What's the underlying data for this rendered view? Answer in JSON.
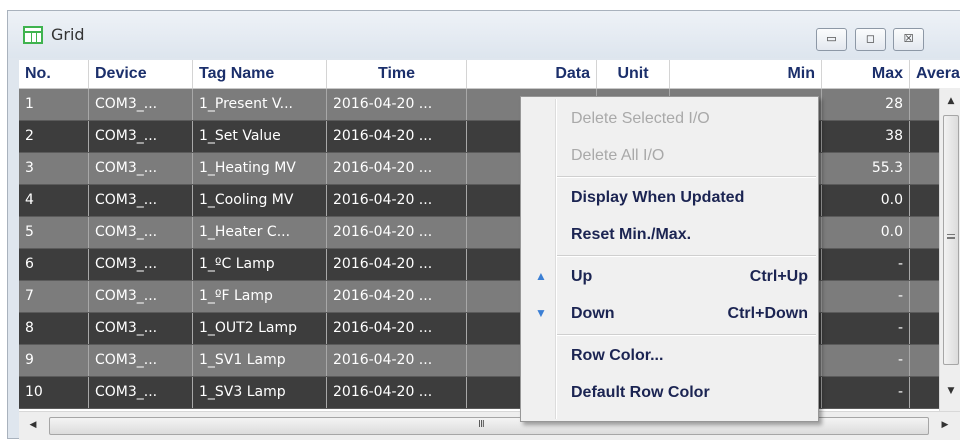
{
  "window": {
    "title": "Grid",
    "icon": "grid-window-icon",
    "buttons": {
      "minimize": "▭",
      "maximize": "◻",
      "close": "☒"
    }
  },
  "columns": [
    "No.",
    "Device",
    "Tag Name",
    "Time",
    "Data",
    "Unit",
    "Min",
    "Max",
    "Avera"
  ],
  "rows": [
    {
      "no": "1",
      "device": "COM3_...",
      "tag": "1_Present V...",
      "time": "2016-04-20 ...",
      "max": "28"
    },
    {
      "no": "2",
      "device": "COM3_...",
      "tag": "1_Set Value",
      "time": "2016-04-20 ...",
      "max": "38"
    },
    {
      "no": "3",
      "device": "COM3_...",
      "tag": "1_Heating MV",
      "time": "2016-04-20 ...",
      "max": "55.3"
    },
    {
      "no": "4",
      "device": "COM3_...",
      "tag": "1_Cooling MV",
      "time": "2016-04-20 ...",
      "max": "0.0"
    },
    {
      "no": "5",
      "device": "COM3_...",
      "tag": "1_Heater C...",
      "time": "2016-04-20 ...",
      "max": "0.0"
    },
    {
      "no": "6",
      "device": "COM3_...",
      "tag": "1_ºC Lamp",
      "time": "2016-04-20 ...",
      "max": "-"
    },
    {
      "no": "7",
      "device": "COM3_...",
      "tag": "1_ºF Lamp",
      "time": "2016-04-20 ...",
      "max": "-"
    },
    {
      "no": "8",
      "device": "COM3_...",
      "tag": "1_OUT2 Lamp",
      "time": "2016-04-20 ...",
      "max": "-"
    },
    {
      "no": "9",
      "device": "COM3_...",
      "tag": "1_SV1 Lamp",
      "time": "2016-04-20 ...",
      "max": "-"
    },
    {
      "no": "10",
      "device": "COM3_...",
      "tag": "1_SV3 Lamp",
      "time": "2016-04-20 ...",
      "max": "-"
    }
  ],
  "colors": {
    "row_odd": "#7c7c7c",
    "row_even": "#3d3d3d",
    "header_text": "#1b2f6b",
    "menu_icon": "#3b7fd4"
  },
  "scrollbar": {
    "up": "▲",
    "down": "▼",
    "left": "◀",
    "right": "▶",
    "h_grip": "III"
  },
  "context_menu": {
    "items": [
      {
        "label": "Delete Selected I/O",
        "disabled": true
      },
      {
        "label": "Delete All I/O",
        "disabled": true
      },
      {
        "label": "Display When Updated"
      },
      {
        "label": "Reset Min./Max."
      },
      {
        "label": "Up",
        "shortcut": "Ctrl+Up",
        "icon": "arrow-up-icon",
        "glyph": "▲"
      },
      {
        "label": "Down",
        "shortcut": "Ctrl+Down",
        "icon": "arrow-down-icon",
        "glyph": "▼"
      },
      {
        "label": "Row Color..."
      },
      {
        "label": "Default Row Color"
      }
    ]
  }
}
